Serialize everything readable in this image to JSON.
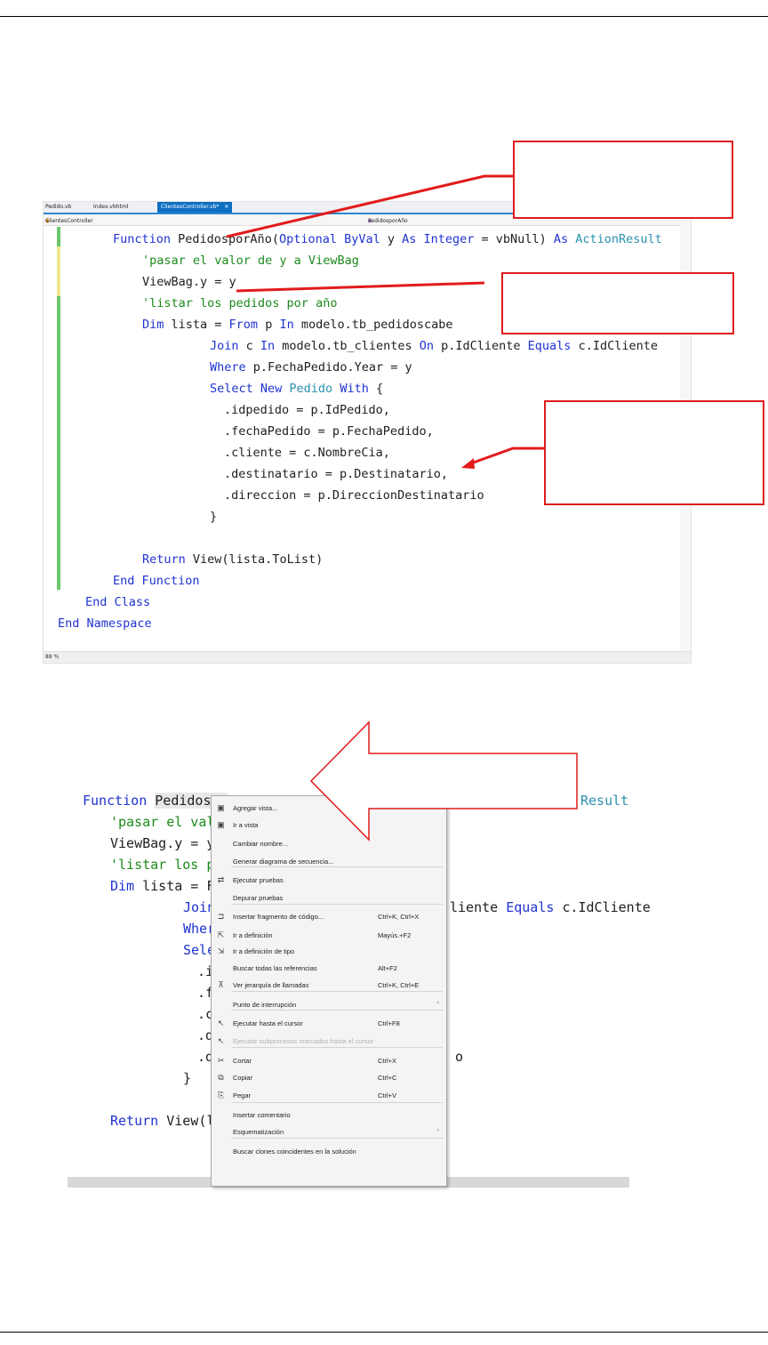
{
  "editor": {
    "tabs": [
      "Pedido.vb",
      "Index.vbhtml",
      "ClientesController.vb*"
    ],
    "tab_close": "✕",
    "nav_left": "ClientesController",
    "nav_right": "PedidosporAño",
    "zoom": "88 %",
    "code": {
      "l1a": "Function ",
      "l1b": "PedidosporAño(",
      "l1c": "Optional ByVal ",
      "l1d": "y ",
      "l1e": "As Integer ",
      "l1f": "= vbNull) ",
      "l1g": "As ",
      "l1h": "ActionResult",
      "l2": "'pasar el valor de y a ViewBag",
      "l3": "ViewBag.y = y",
      "l4": "'listar los pedidos por año",
      "l5a": "Dim ",
      "l5b": "lista = ",
      "l5c": "From ",
      "l5d": "p ",
      "l5e": "In ",
      "l5f": "modelo.tb_pedidoscabe",
      "l6a": "Join ",
      "l6b": "c ",
      "l6c": "In ",
      "l6d": "modelo.tb_clientes ",
      "l6e": "On ",
      "l6f": "p.IdCliente ",
      "l6g": "Equals ",
      "l6h": "c.IdCliente",
      "l7a": "Where ",
      "l7b": "p.FechaPedido.Year = y",
      "l8a": "Select New ",
      "l8b": "Pedido ",
      "l8c": "With ",
      "l8d": "{",
      "l9": ".idpedido = p.IdPedido,",
      "l10": ".fechaPedido = p.FechaPedido,",
      "l11": ".cliente = c.NombreCia,",
      "l12": ".destinatario = p.Destinatario,",
      "l13": ".direccion = p.DireccionDestinatario",
      "l14": "}",
      "l15a": "Return ",
      "l15b": "View(lista.ToList)",
      "l16": "End Function",
      "l17": "End Class",
      "l18": "End Namespace"
    }
  },
  "editor2": {
    "code": {
      "l1a": "Function ",
      "l1b": "Pedidospo",
      "l1c": "Result",
      "l2": "'pasar el valo",
      "l3": "ViewBag.y = y",
      "l4": "'listar los pe",
      "l5a": "Dim ",
      "l5b": "lista = Fr",
      "l6a": "Join",
      "l6b": "liente ",
      "l6c": "Equals ",
      "l6d": "c.IdCliente",
      "l7": "Wher",
      "l8": "Sele",
      "l9": ".i",
      "l10": ".f",
      "l11": ".c",
      "l12": ".d",
      "l13a": ".d",
      "l13b": "o",
      "l14": "}",
      "l15": "Return View(li"
    }
  },
  "context_menu": {
    "items": [
      {
        "icon": "add-view-icon",
        "glyph": "▣",
        "label": "Agregar vista...",
        "shortcut": ""
      },
      {
        "icon": "go-to-view-icon",
        "glyph": "▣",
        "label": "Ir a vista",
        "shortcut": ""
      },
      {
        "icon": "",
        "glyph": "",
        "label": "Cambiar nombre...",
        "shortcut": ""
      },
      {
        "icon": "",
        "glyph": "",
        "label": "Generar diagrama de secuencia...",
        "shortcut": ""
      },
      {
        "icon": "run-tests-icon",
        "glyph": "⇄",
        "label": "Ejecutar pruebas",
        "shortcut": ""
      },
      {
        "icon": "",
        "glyph": "",
        "label": "Depurar pruebas",
        "shortcut": ""
      },
      {
        "icon": "snippet-icon",
        "glyph": "⊐",
        "label": "Insertar fragmento de código...",
        "shortcut": "Ctrl+K, Ctrl+X"
      },
      {
        "icon": "go-to-definition-icon",
        "glyph": "⇱",
        "label": "Ir a definición",
        "shortcut": "Mayús.+F2"
      },
      {
        "icon": "go-to-type-definition-icon",
        "glyph": "⇲",
        "label": "Ir a definición de tipo",
        "shortcut": ""
      },
      {
        "icon": "",
        "glyph": "",
        "label": "Buscar todas las referencias",
        "shortcut": "Alt+F2"
      },
      {
        "icon": "call-hierarchy-icon",
        "glyph": "⊼",
        "label": "Ver jerarquía de llamadas",
        "shortcut": "Ctrl+K, Ctrl+E"
      },
      {
        "icon": "",
        "glyph": "",
        "label": "Punto de interrupción",
        "shortcut": "",
        "submenu": "›"
      },
      {
        "icon": "run-to-cursor-icon",
        "glyph": "↖",
        "label": "Ejecutar hasta el cursor",
        "shortcut": "Ctrl+F8"
      },
      {
        "icon": "run-flagged-threads-icon",
        "glyph": "↖",
        "label": "Ejecutar subprocesos marcados hasta el cursor",
        "shortcut": "",
        "disabled": true
      },
      {
        "icon": "cut-icon",
        "glyph": "✂",
        "label": "Cortar",
        "shortcut": "Ctrl+X"
      },
      {
        "icon": "copy-icon",
        "glyph": "⧉",
        "label": "Copiar",
        "shortcut": "Ctrl+C"
      },
      {
        "icon": "paste-icon",
        "glyph": "⎘",
        "label": "Pegar",
        "shortcut": "Ctrl+V"
      },
      {
        "icon": "",
        "glyph": "",
        "label": "Insertar comentario",
        "shortcut": ""
      },
      {
        "icon": "",
        "glyph": "",
        "label": "Esquematización",
        "shortcut": "",
        "submenu": "›"
      },
      {
        "icon": "",
        "glyph": "",
        "label": "Buscar clones coincidentes en la solución",
        "shortcut": ""
      }
    ]
  },
  "colors": {
    "callout_red": "#e21b1b",
    "keyword_blue": "#1f33d1",
    "comment_green": "#1d8a1d",
    "type_teal": "#2b91af"
  }
}
